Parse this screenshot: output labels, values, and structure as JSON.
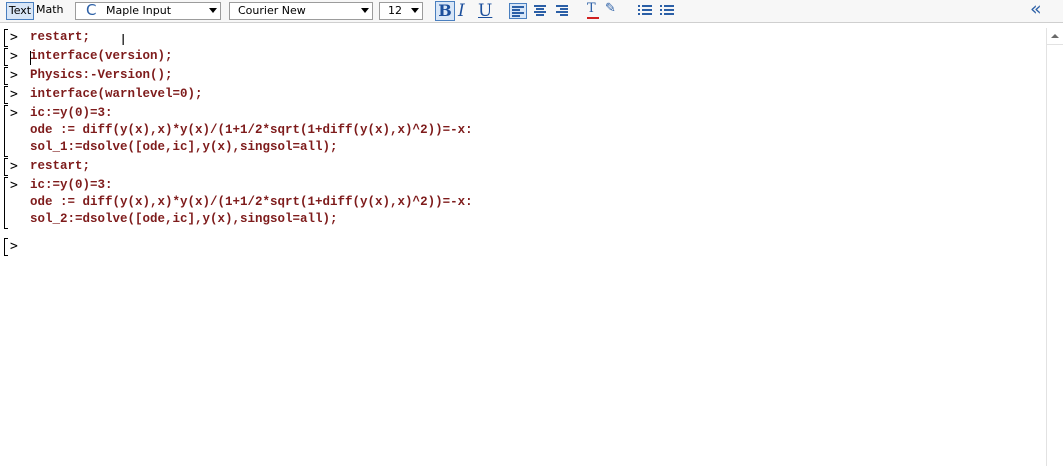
{
  "toolbar": {
    "mode_text": "Text",
    "mode_math": "Math",
    "input_mode_glyph": "C",
    "input_mode": "Maple Input",
    "font_family": "Courier New",
    "font_size": "12",
    "bold_label": "B",
    "italic_label": "I",
    "underline_label": "U",
    "text_color_glyph": "T",
    "highlight_glyph": "✎",
    "collapse_glyph": "«",
    "icons": [
      "align-left-icon",
      "align-center-icon",
      "align-right-icon",
      "text-color-icon",
      "highlight-icon",
      "bullet-list-icon",
      "numbered-list-icon",
      "collapse-panel-icon"
    ]
  },
  "worksheet": {
    "prompt": ">",
    "groups": [
      {
        "lines": [
          "restart;"
        ]
      },
      {
        "lines": [
          "interface(version);"
        ]
      },
      {
        "lines": [
          "Physics:-Version();"
        ]
      },
      {
        "lines": [
          "interface(warnlevel=0);"
        ]
      },
      {
        "lines": [
          "ic:=y(0)=3:",
          "ode := diff(y(x),x)*y(x)/(1+1/2*sqrt(1+diff(y(x),x)^2))=-x:",
          "sol_1:=dsolve([ode,ic],y(x),singsol=all);"
        ]
      },
      {
        "lines": [
          "restart;"
        ]
      },
      {
        "lines": [
          "ic:=y(0)=3:",
          "ode := diff(y(x),x)*y(x)/(1+1/2*sqrt(1+diff(y(x),x)^2))=-x:",
          "sol_2:=dsolve([ode,ic],y(x),singsol=all);"
        ]
      },
      {
        "lines": [
          ""
        ]
      }
    ]
  },
  "colors": {
    "input_text": "#7e1b1b",
    "toolbar_icons": "#2b5fa6",
    "selected_background": "#d8e6f7"
  }
}
